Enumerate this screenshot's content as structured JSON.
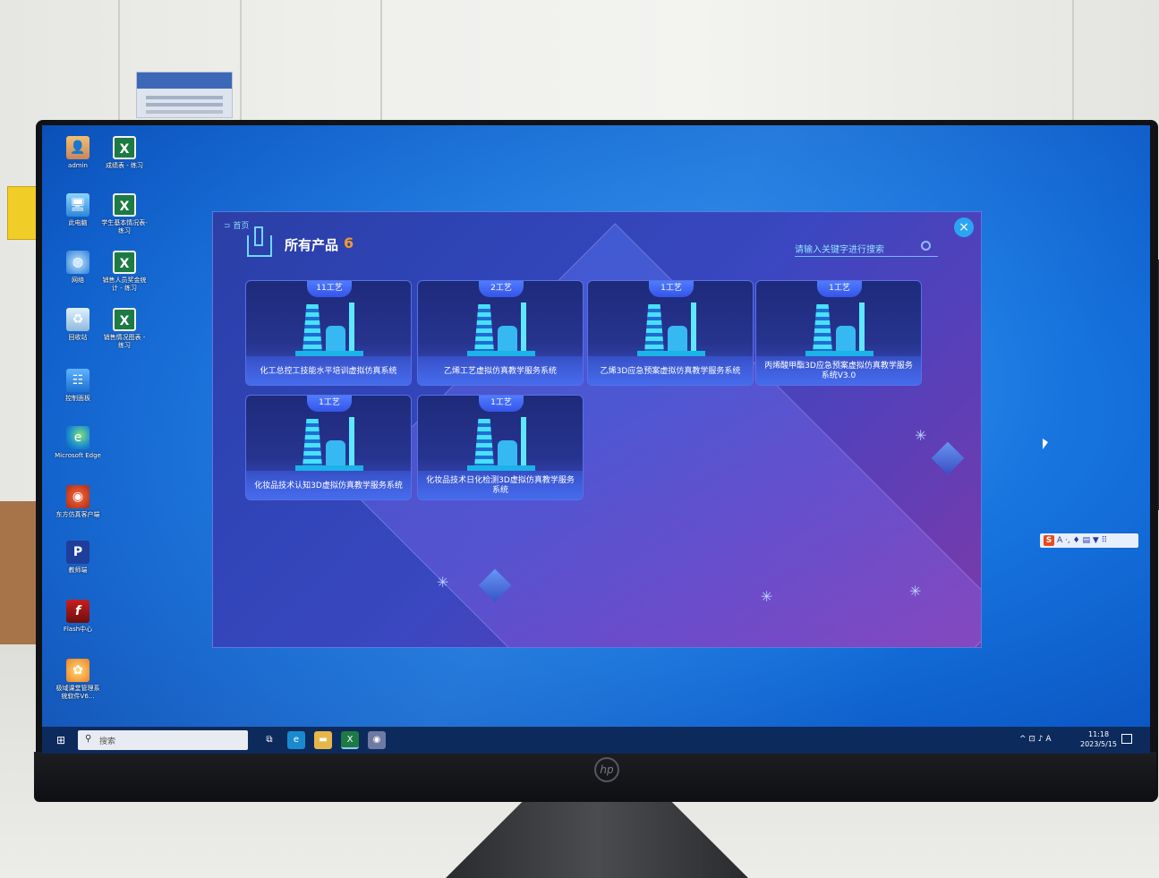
{
  "desktop": {
    "icons": [
      {
        "label": "admin",
        "glyph": "👤"
      },
      {
        "label": "成绩表 - 练习",
        "glyph": "X"
      },
      {
        "label": "此电脑",
        "glyph": "🖥"
      },
      {
        "label": "学生基本情况表-练习",
        "glyph": "X"
      },
      {
        "label": "网络",
        "glyph": "◍"
      },
      {
        "label": "销售人员奖金统计 - 练习",
        "glyph": "X"
      },
      {
        "label": "回收站",
        "glyph": "♻"
      },
      {
        "label": "销售情况图表 - 练习",
        "glyph": "X"
      },
      {
        "label": "控制面板",
        "glyph": "☷"
      },
      {
        "label": "Microsoft Edge",
        "glyph": "e"
      },
      {
        "label": "东方仿真客户端",
        "glyph": "◉"
      },
      {
        "label": "教师端",
        "glyph": "P"
      },
      {
        "label": "Flash中心",
        "glyph": "f"
      },
      {
        "label": "极域课堂管理系统软件V6...",
        "glyph": "✿"
      }
    ]
  },
  "app": {
    "back_label": "⊃ 首页",
    "title": "所有产品",
    "count": "6",
    "close_glyph": "×",
    "search_placeholder": "请输入关键字进行搜索",
    "products": [
      {
        "badge": "11工艺",
        "name": "化工总控工技能水平培训虚拟仿真系统"
      },
      {
        "badge": "2工艺",
        "name": "乙烯工艺虚拟仿真教学服务系统"
      },
      {
        "badge": "1工艺",
        "name": "乙烯3D应急预案虚拟仿真教学服务系统"
      },
      {
        "badge": "1工艺",
        "name": "丙烯酸甲酯3D应急预案虚拟仿真教学服务系统V3.0"
      },
      {
        "badge": "1工艺",
        "name": "化妆品技术认知3D虚拟仿真教学服务系统"
      },
      {
        "badge": "1工艺",
        "name": "化妆品技术日化检测3D虚拟仿真教学服务系统"
      }
    ]
  },
  "ime": {
    "logo": "S",
    "text": "A ·, ♦ ▤ ▼ ⠿"
  },
  "taskbar": {
    "start_glyph": "⊞",
    "search_placeholder": "搜索",
    "search_glyph": "⚲",
    "pinned": [
      {
        "name": "task-view",
        "glyph": "⧉",
        "color": "#0d2a5c"
      },
      {
        "name": "edge",
        "glyph": "e",
        "color": "#1a8ad0"
      },
      {
        "name": "file-explorer",
        "glyph": "▬",
        "color": "#e7b64a"
      },
      {
        "name": "excel",
        "glyph": "X",
        "color": "#1d7a45"
      },
      {
        "name": "simulation",
        "glyph": "◉",
        "color": "#6e7aa3"
      }
    ],
    "tray": "^ ⊡ ♪ A",
    "time": "11:18",
    "date": "2023/5/15"
  }
}
